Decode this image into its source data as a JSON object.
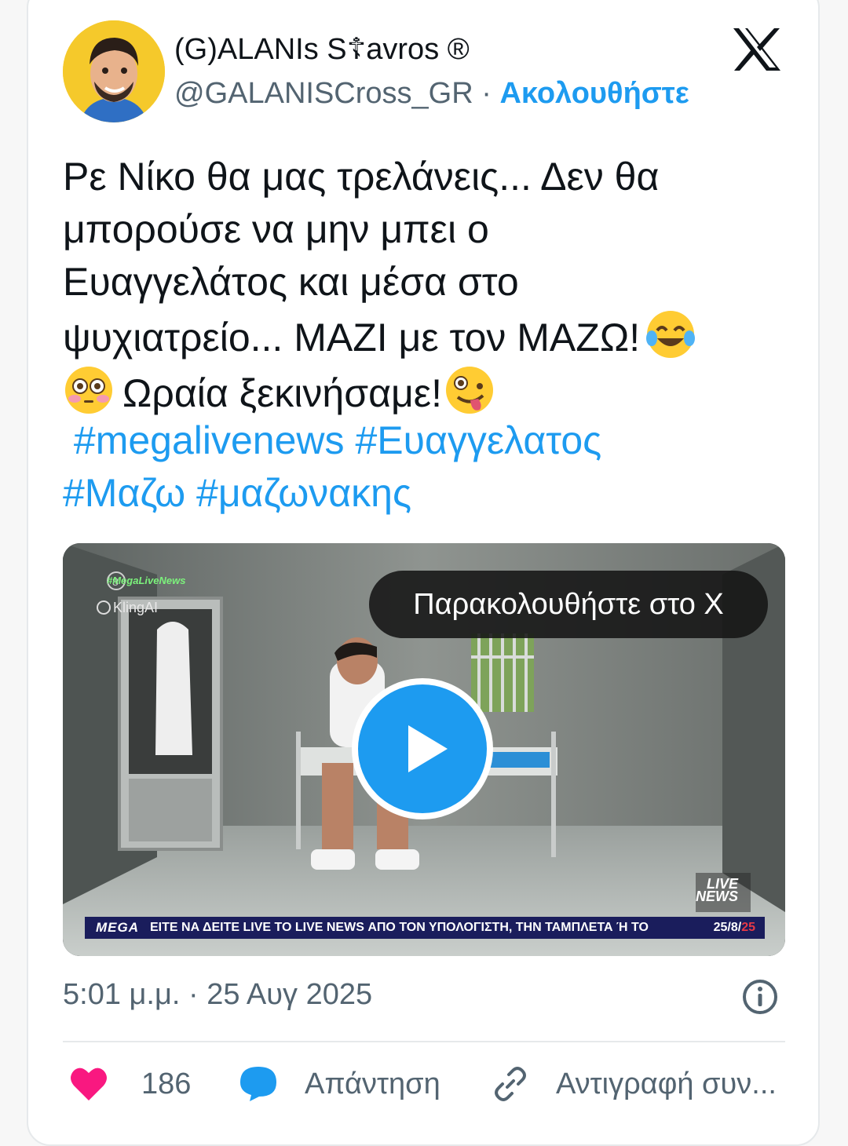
{
  "tweet": {
    "display_name": "(G)ALANIs S☦avros ®",
    "handle": "@GALANISCross_GR",
    "separator": "·",
    "follow_label": "Ακολουθήστε",
    "text_lines": [
      "Ρε Νίκο θα μας τρελάνεις... Δεν θα",
      "μπορούσε να μην μπει ο",
      "Ευαγγελάτος και μέσα στο",
      "ψυχιατρείο... ΜΑΖΙ με τον ΜΑΖΩ!",
      "Ωραία ξεκινήσαμε!"
    ],
    "emojis": [
      "tears-of-joy-emoji",
      "flushed-face-emoji",
      "zany-face-emoji"
    ],
    "hashtags": [
      "#megalivenews",
      "#Ευαγγελατος",
      "#Μαζω",
      "#μαζωνακης"
    ],
    "timestamp": "5:01 μ.μ. · 25 Αυγ 2025"
  },
  "video": {
    "watch_label": "Παρακολουθήστε στο X",
    "overlay_tag": "#MegaLiveNews",
    "kling_label": "KlingAI",
    "channel_logo": "MEGA",
    "ticker_text": "ΕΙΤΕ ΝΑ ΔΕΙΤΕ LIVE ΤΟ LIVE NEWS ΑΠΟ ΤΟΝ ΥΠΟΛΟΓΙΣΤΗ, ΤΗΝ ΤΑΜΠΛΕΤΑ Ή ΤΟ",
    "ticker_date_prefix": "25/8/",
    "ticker_date_suffix": "25",
    "live_logo_line1": "LIVE",
    "live_logo_line2": "NEWS"
  },
  "actions": {
    "likes_count": "186",
    "reply_label": "Απάντηση",
    "copy_label": "Αντιγραφή συν..."
  },
  "colors": {
    "accent": "#1d9bf0",
    "heart": "#f91880",
    "muted": "#536471"
  }
}
